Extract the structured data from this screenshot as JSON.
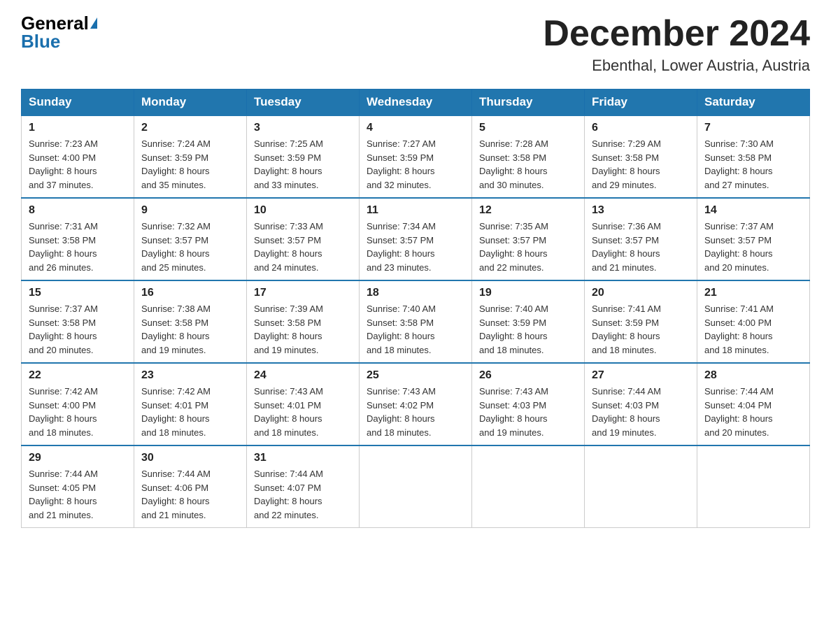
{
  "header": {
    "logo_general": "General",
    "logo_blue": "Blue",
    "month_title": "December 2024",
    "location": "Ebenthal, Lower Austria, Austria"
  },
  "days_of_week": [
    "Sunday",
    "Monday",
    "Tuesday",
    "Wednesday",
    "Thursday",
    "Friday",
    "Saturday"
  ],
  "weeks": [
    [
      {
        "day": "1",
        "sunrise": "7:23 AM",
        "sunset": "4:00 PM",
        "daylight": "8 hours and 37 minutes."
      },
      {
        "day": "2",
        "sunrise": "7:24 AM",
        "sunset": "3:59 PM",
        "daylight": "8 hours and 35 minutes."
      },
      {
        "day": "3",
        "sunrise": "7:25 AM",
        "sunset": "3:59 PM",
        "daylight": "8 hours and 33 minutes."
      },
      {
        "day": "4",
        "sunrise": "7:27 AM",
        "sunset": "3:59 PM",
        "daylight": "8 hours and 32 minutes."
      },
      {
        "day": "5",
        "sunrise": "7:28 AM",
        "sunset": "3:58 PM",
        "daylight": "8 hours and 30 minutes."
      },
      {
        "day": "6",
        "sunrise": "7:29 AM",
        "sunset": "3:58 PM",
        "daylight": "8 hours and 29 minutes."
      },
      {
        "day": "7",
        "sunrise": "7:30 AM",
        "sunset": "3:58 PM",
        "daylight": "8 hours and 27 minutes."
      }
    ],
    [
      {
        "day": "8",
        "sunrise": "7:31 AM",
        "sunset": "3:58 PM",
        "daylight": "8 hours and 26 minutes."
      },
      {
        "day": "9",
        "sunrise": "7:32 AM",
        "sunset": "3:57 PM",
        "daylight": "8 hours and 25 minutes."
      },
      {
        "day": "10",
        "sunrise": "7:33 AM",
        "sunset": "3:57 PM",
        "daylight": "8 hours and 24 minutes."
      },
      {
        "day": "11",
        "sunrise": "7:34 AM",
        "sunset": "3:57 PM",
        "daylight": "8 hours and 23 minutes."
      },
      {
        "day": "12",
        "sunrise": "7:35 AM",
        "sunset": "3:57 PM",
        "daylight": "8 hours and 22 minutes."
      },
      {
        "day": "13",
        "sunrise": "7:36 AM",
        "sunset": "3:57 PM",
        "daylight": "8 hours and 21 minutes."
      },
      {
        "day": "14",
        "sunrise": "7:37 AM",
        "sunset": "3:57 PM",
        "daylight": "8 hours and 20 minutes."
      }
    ],
    [
      {
        "day": "15",
        "sunrise": "7:37 AM",
        "sunset": "3:58 PM",
        "daylight": "8 hours and 20 minutes."
      },
      {
        "day": "16",
        "sunrise": "7:38 AM",
        "sunset": "3:58 PM",
        "daylight": "8 hours and 19 minutes."
      },
      {
        "day": "17",
        "sunrise": "7:39 AM",
        "sunset": "3:58 PM",
        "daylight": "8 hours and 19 minutes."
      },
      {
        "day": "18",
        "sunrise": "7:40 AM",
        "sunset": "3:58 PM",
        "daylight": "8 hours and 18 minutes."
      },
      {
        "day": "19",
        "sunrise": "7:40 AM",
        "sunset": "3:59 PM",
        "daylight": "8 hours and 18 minutes."
      },
      {
        "day": "20",
        "sunrise": "7:41 AM",
        "sunset": "3:59 PM",
        "daylight": "8 hours and 18 minutes."
      },
      {
        "day": "21",
        "sunrise": "7:41 AM",
        "sunset": "4:00 PM",
        "daylight": "8 hours and 18 minutes."
      }
    ],
    [
      {
        "day": "22",
        "sunrise": "7:42 AM",
        "sunset": "4:00 PM",
        "daylight": "8 hours and 18 minutes."
      },
      {
        "day": "23",
        "sunrise": "7:42 AM",
        "sunset": "4:01 PM",
        "daylight": "8 hours and 18 minutes."
      },
      {
        "day": "24",
        "sunrise": "7:43 AM",
        "sunset": "4:01 PM",
        "daylight": "8 hours and 18 minutes."
      },
      {
        "day": "25",
        "sunrise": "7:43 AM",
        "sunset": "4:02 PM",
        "daylight": "8 hours and 18 minutes."
      },
      {
        "day": "26",
        "sunrise": "7:43 AM",
        "sunset": "4:03 PM",
        "daylight": "8 hours and 19 minutes."
      },
      {
        "day": "27",
        "sunrise": "7:44 AM",
        "sunset": "4:03 PM",
        "daylight": "8 hours and 19 minutes."
      },
      {
        "day": "28",
        "sunrise": "7:44 AM",
        "sunset": "4:04 PM",
        "daylight": "8 hours and 20 minutes."
      }
    ],
    [
      {
        "day": "29",
        "sunrise": "7:44 AM",
        "sunset": "4:05 PM",
        "daylight": "8 hours and 21 minutes."
      },
      {
        "day": "30",
        "sunrise": "7:44 AM",
        "sunset": "4:06 PM",
        "daylight": "8 hours and 21 minutes."
      },
      {
        "day": "31",
        "sunrise": "7:44 AM",
        "sunset": "4:07 PM",
        "daylight": "8 hours and 22 minutes."
      },
      null,
      null,
      null,
      null
    ]
  ],
  "labels": {
    "sunrise": "Sunrise:",
    "sunset": "Sunset:",
    "daylight": "Daylight:"
  }
}
